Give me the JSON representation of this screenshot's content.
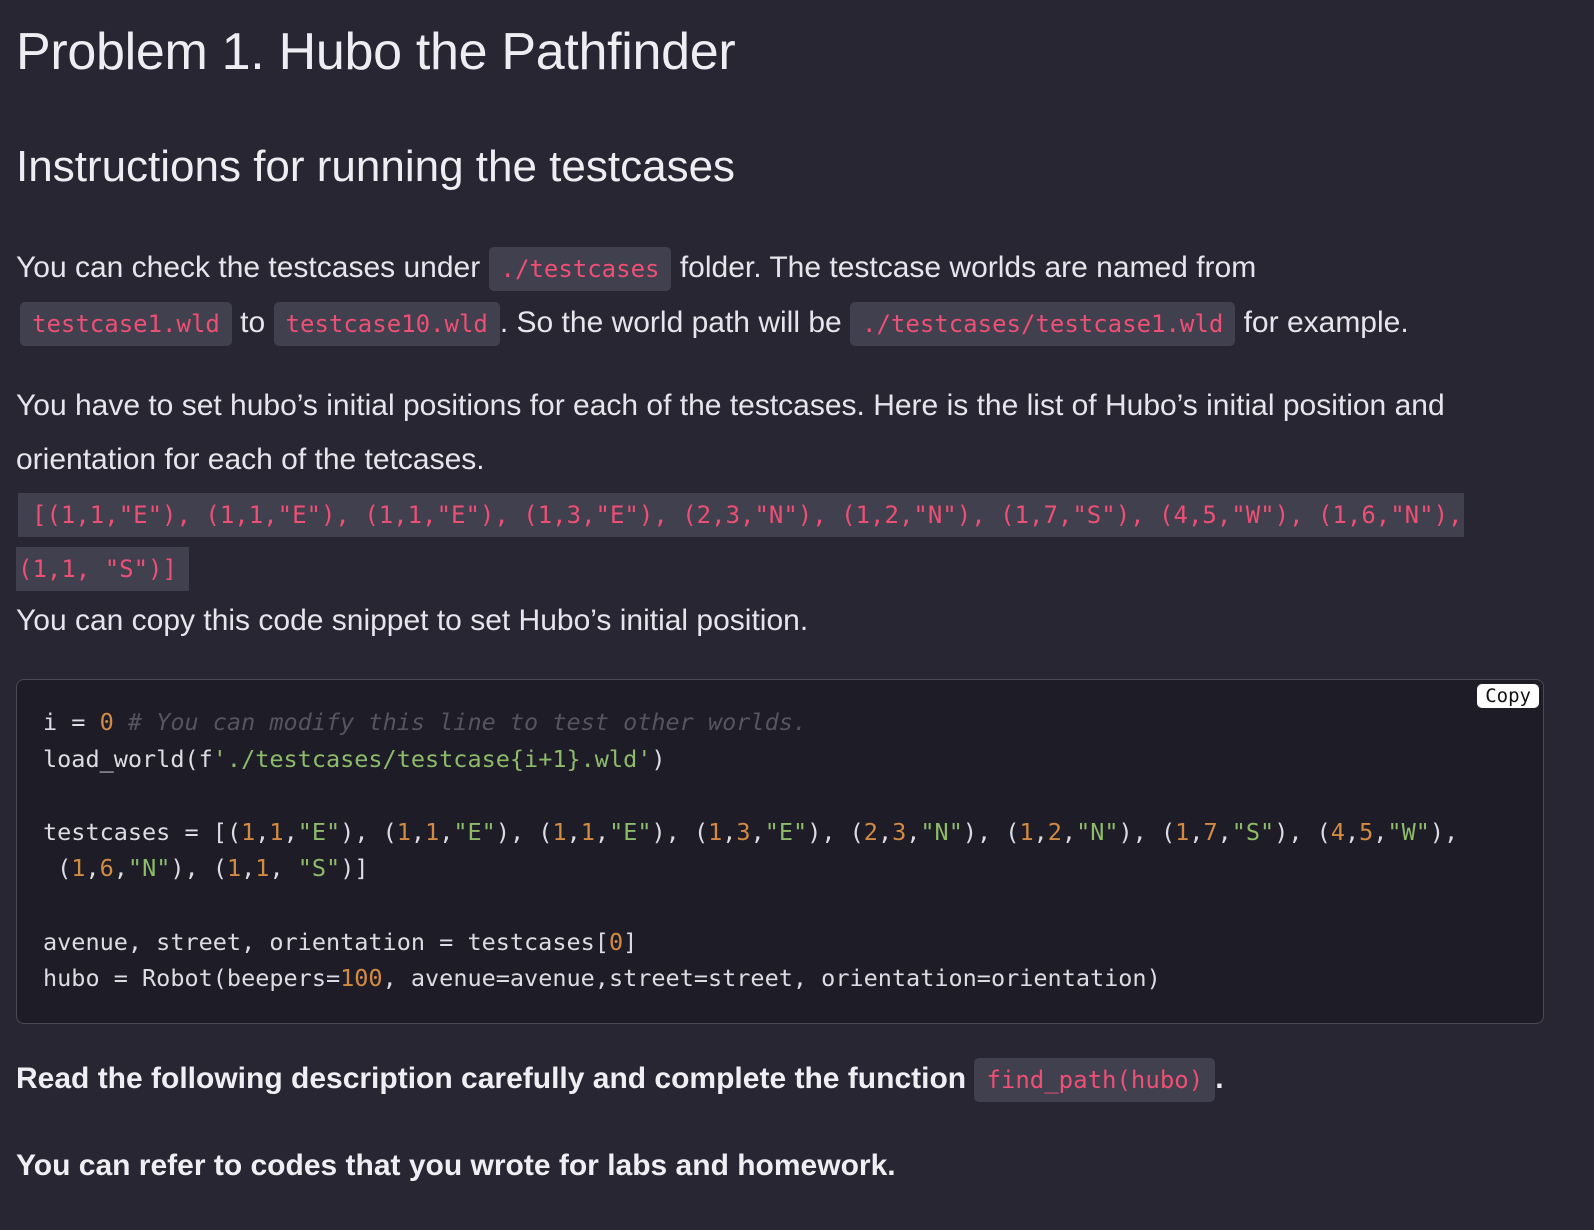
{
  "title": "Problem 1. Hubo the Pathfinder",
  "section_heading": "Instructions for running the testcases",
  "p1": {
    "t1": "You can check the testcases under ",
    "code1": "./testcases",
    "t2": " folder. The testcase worlds are named from",
    "code2": "testcase1.wld",
    "t3": " to ",
    "code3": "testcase10.wld",
    "t4": ". So the world path will be ",
    "code4": "./testcases/testcase1.wld",
    "t5": " for example."
  },
  "p2": {
    "text": "You have to set hubo’s initial positions for each of the testcases. Here is the list of Hubo’s initial position and orientation for each of the tetcases."
  },
  "tuple_list": {
    "line1": "[(1,1,\"E\"), (1,1,\"E\"), (1,1,\"E\"), (1,3,\"E\"), (2,3,\"N\"), (1,2,\"N\"), (1,7,\"S\"), (4,5,\"W\"), (1,6,\"N\"),",
    "line2": "(1,1, \"S\")]"
  },
  "p3": {
    "text": "You can copy this code snippet to set Hubo’s initial position."
  },
  "codeblock": {
    "copy_label": "Copy",
    "line1_a": "i = ",
    "line1_num": "0",
    "line1_comment": " # You can modify this line to test other worlds.",
    "line2_a": "load_world(f",
    "line2_str": "'./testcases/testcase{i+1}.wld'",
    "line2_b": ")",
    "line4_a": "testcases = [",
    "line7_a": "avenue, street, orientation = testcases[",
    "line7_num": "0",
    "line7_b": "]",
    "line8_a": "hubo = Robot(beepers=",
    "line8_num": "100",
    "line8_b": ", avenue=avenue,street=street, orientation=orientation)"
  },
  "instruction": {
    "text": "Read the following description carefully and complete the function ",
    "code": "find_path(hubo)",
    "end": "."
  },
  "note": {
    "text": "You can refer to codes that you wrote for labs and homework."
  }
}
